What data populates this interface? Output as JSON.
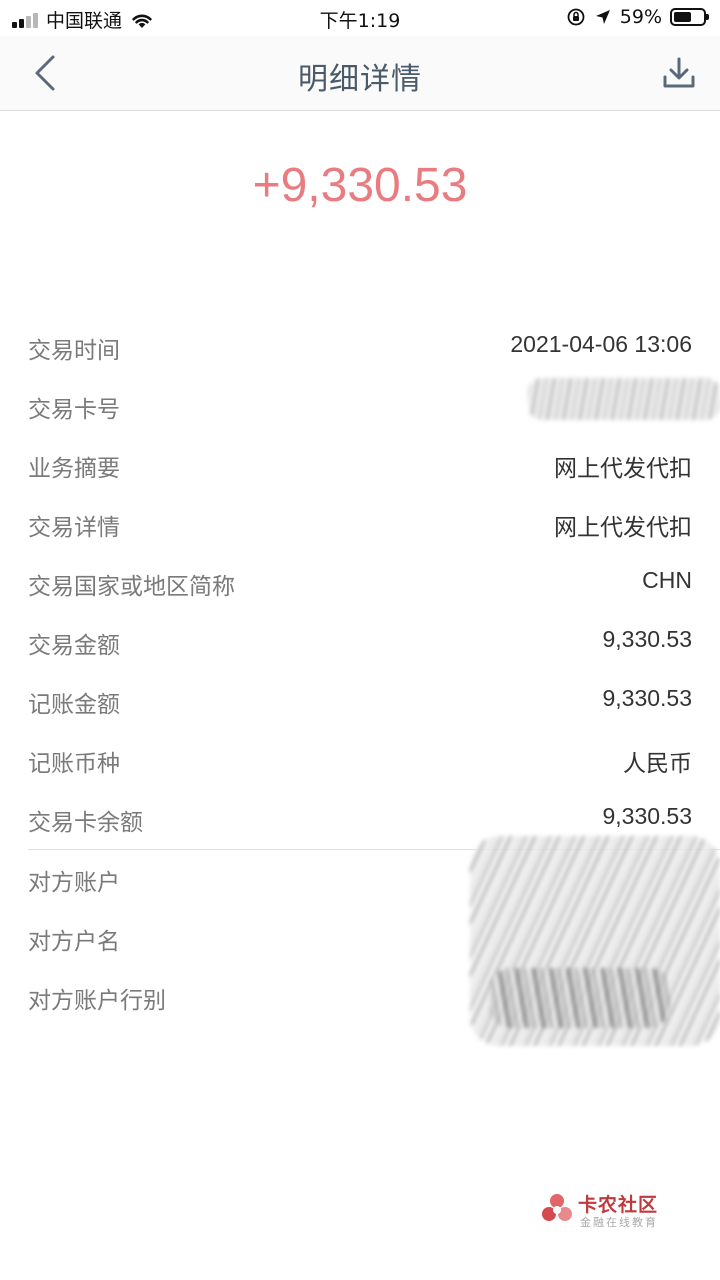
{
  "status_bar": {
    "carrier": "中国联通",
    "time": "下午1:19",
    "battery_percent": "59%",
    "battery_level": 0.59
  },
  "nav": {
    "title": "明细详情",
    "back_icon": "chevron-left-icon",
    "download_icon": "download-icon"
  },
  "amount": "+9,330.53",
  "details": [
    {
      "label": "交易时间",
      "value": "2021-04-06 13:06"
    },
    {
      "label": "交易卡号",
      "value": ""
    },
    {
      "label": "业务摘要",
      "value": "网上代发代扣"
    },
    {
      "label": "交易详情",
      "value": "网上代发代扣"
    },
    {
      "label": "交易国家或地区简称",
      "value": "CHN"
    },
    {
      "label": "交易金额",
      "value": "9,330.53"
    },
    {
      "label": "记账金额",
      "value": "9,330.53"
    },
    {
      "label": "记账币种",
      "value": "人民币"
    },
    {
      "label": "交易卡余额",
      "value": "9,330.53"
    }
  ],
  "counterparty": [
    {
      "label": "对方账户",
      "value": ""
    },
    {
      "label": "对方户名",
      "value": ""
    },
    {
      "label": "对方账户行别",
      "value": ""
    }
  ],
  "colors": {
    "amount": "#e87c80",
    "nav_title": "#4a5a6a",
    "label": "#7a7a7a",
    "brand_red": "#c0393d"
  },
  "watermark": {
    "name": "卡农社区",
    "tagline": "金融在线教育"
  }
}
